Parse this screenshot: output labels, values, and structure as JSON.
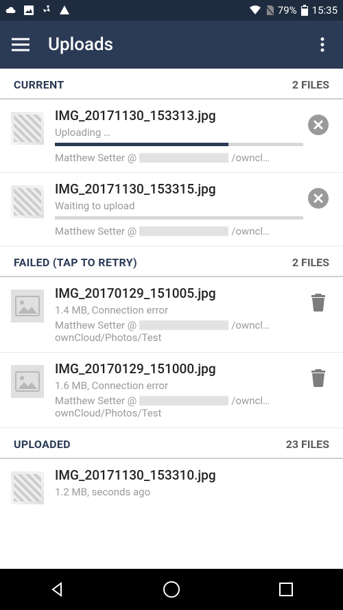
{
  "status_bar": {
    "battery_pct": "79%",
    "time": "15:35"
  },
  "app_bar": {
    "title": "Uploads"
  },
  "sections": {
    "current": {
      "title": "CURRENT",
      "count": "2 FILES"
    },
    "failed": {
      "title": "FAILED (TAP TO RETRY)",
      "count": "2 FILES"
    },
    "uploaded": {
      "title": "UPLOADED",
      "count": "23 FILES"
    }
  },
  "current_items": [
    {
      "filename": "IMG_20171130_153313.jpg",
      "status": "Uploading …",
      "progress_pct": 70,
      "account_prefix": "Matthew Setter @",
      "account_suffix": "/owncl…"
    },
    {
      "filename": "IMG_20171130_153315.jpg",
      "status": "Waiting to upload",
      "progress_pct": 0,
      "account_prefix": "Matthew Setter @",
      "account_suffix": "/owncl…"
    }
  ],
  "failed_items": [
    {
      "filename": "IMG_20170129_151005.jpg",
      "status": "1.4 MB, Connection error",
      "account_prefix": "Matthew Setter @",
      "account_suffix": "/owncl…",
      "path": "ownCloud/Photos/Test"
    },
    {
      "filename": "IMG_20170129_151000.jpg",
      "status": "1.6 MB, Connection error",
      "account_prefix": "Matthew Setter @",
      "account_suffix": "/owncl…",
      "path": "ownCloud/Photos/Test"
    }
  ],
  "uploaded_items": [
    {
      "filename": "IMG_20171130_153310.jpg",
      "status": "1.2 MB,  seconds ago"
    }
  ]
}
